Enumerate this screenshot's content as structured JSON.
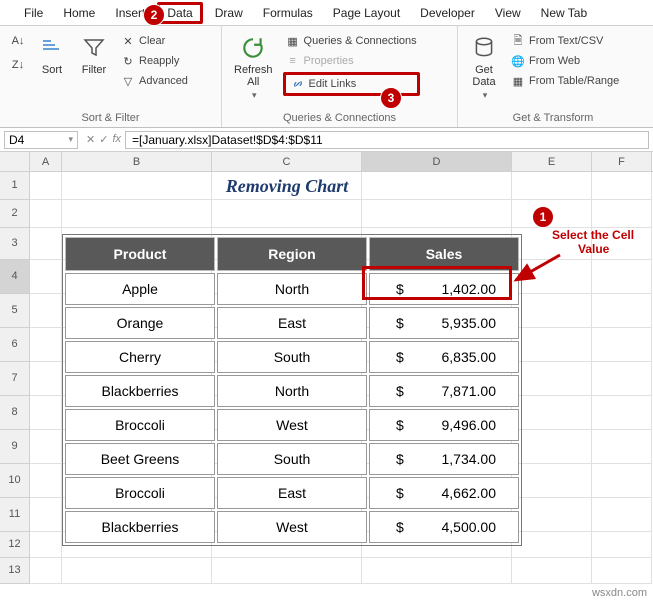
{
  "menubar": {
    "items": [
      "File",
      "Home",
      "Insert",
      "Data",
      "Draw",
      "Formulas",
      "Page Layout",
      "Developer",
      "View",
      "New Tab"
    ]
  },
  "ribbon": {
    "sort_filter": {
      "sort": "Sort",
      "filter": "Filter",
      "clear": "Clear",
      "reapply": "Reapply",
      "advanced": "Advanced",
      "group_label": "Sort & Filter"
    },
    "queries": {
      "refresh": "Refresh\nAll",
      "queries_conn": "Queries & Connections",
      "properties": "Properties",
      "edit_links": "Edit Links",
      "group_label": "Queries & Connections"
    },
    "get_transform": {
      "get_data": "Get\nData",
      "from_text": "From Text/CSV",
      "from_web": "From Web",
      "from_table": "From Table/Range",
      "group_label": "Get & Transform"
    }
  },
  "name_box": "D4",
  "formula": "=[January.xlsx]Dataset!$D$4:$D$11",
  "columns": [
    "A",
    "B",
    "C",
    "D",
    "E",
    "F"
  ],
  "rows": [
    "1",
    "2",
    "3",
    "4",
    "5",
    "6",
    "7",
    "8",
    "9",
    "10",
    "11",
    "12",
    "13"
  ],
  "title": "Removing Chart",
  "table": {
    "headers": [
      "Product",
      "Region",
      "Sales"
    ],
    "rows": [
      {
        "product": "Apple",
        "region": "North",
        "sales": "1,402.00"
      },
      {
        "product": "Orange",
        "region": "East",
        "sales": "5,935.00"
      },
      {
        "product": "Cherry",
        "region": "South",
        "sales": "6,835.00"
      },
      {
        "product": "Blackberries",
        "region": "North",
        "sales": "7,871.00"
      },
      {
        "product": "Broccoli",
        "region": "West",
        "sales": "9,496.00"
      },
      {
        "product": "Beet Greens",
        "region": "South",
        "sales": "1,734.00"
      },
      {
        "product": "Broccoli",
        "region": "East",
        "sales": "4,662.00"
      },
      {
        "product": "Blackberries",
        "region": "West",
        "sales": "4,500.00"
      }
    ]
  },
  "annotations": {
    "badge1": "1",
    "badge2": "2",
    "badge3": "3",
    "select_text_l1": "Select the Cell",
    "select_text_l2": "Value"
  },
  "watermark": "wsxdn.com"
}
